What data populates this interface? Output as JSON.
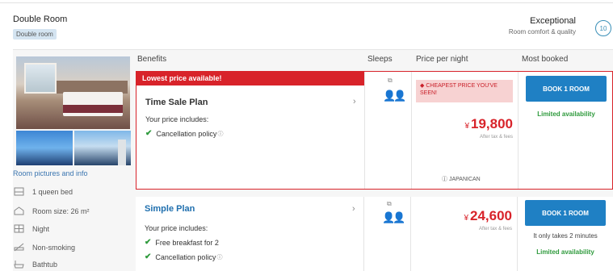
{
  "room": {
    "title": "Double Room",
    "tag": "Double room",
    "rating_label": "Exceptional",
    "rating_sub": "Room comfort & quality",
    "rating_score": "10",
    "photo_link": "Room pictures and info",
    "amenities": [
      {
        "label": "1 queen bed",
        "icon": "bed-icon"
      },
      {
        "label": "Room size: 26 m²",
        "icon": "house-icon"
      },
      {
        "label": "Night",
        "icon": "window-icon"
      },
      {
        "label": "Non-smoking",
        "icon": "no-smoking-icon"
      },
      {
        "label": "Bathtub",
        "icon": "bathtub-icon"
      }
    ]
  },
  "columns": {
    "benefits": "Benefits",
    "sleeps": "Sleeps",
    "price": "Price per night",
    "booked": "Most booked"
  },
  "plans": [
    {
      "banner": "Lowest price available!",
      "name": "Time Sale Plan",
      "includes": "Your price includes:",
      "perks": [
        "Cancellation policy"
      ],
      "badge": "CHEAPEST PRICE YOU'VE SEEN!",
      "currency": "¥",
      "price": "19,800",
      "after_tax": "After tax & fees",
      "provider": "JAPANICAN",
      "book_label": "BOOK 1 ROOM",
      "availability": "Limited availability"
    },
    {
      "name": "Simple Plan",
      "includes": "Your price includes:",
      "perks": [
        "Free breakfast for 2",
        "Cancellation policy"
      ],
      "currency": "¥",
      "price": "24,600",
      "after_tax": "After tax & fees",
      "book_label": "BOOK 1 ROOM",
      "quick": "It only takes 2 minutes",
      "availability": "Limited availability"
    }
  ],
  "colors": {
    "accent_red": "#d8232a",
    "button_blue": "#1f80c4",
    "check_green": "#2e9a3c"
  }
}
